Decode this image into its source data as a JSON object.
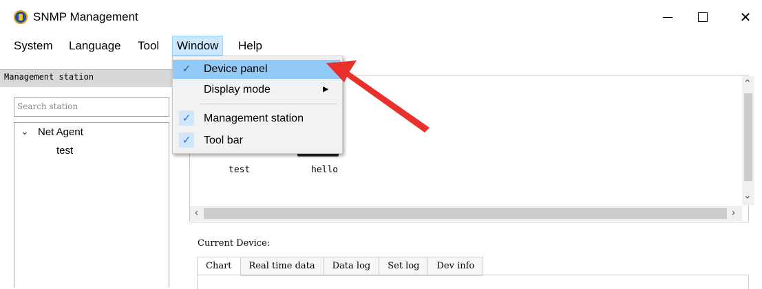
{
  "window": {
    "title": "SNMP Management"
  },
  "menubar": {
    "items": [
      {
        "label": "System"
      },
      {
        "label": "Language"
      },
      {
        "label": "Tool"
      },
      {
        "label": "Window"
      },
      {
        "label": "Help"
      }
    ]
  },
  "window_menu": {
    "items": [
      {
        "label": "Device panel",
        "checked": true,
        "highlighted": true
      },
      {
        "label": "Display mode",
        "checked": false,
        "has_submenu": true
      },
      {
        "label": "Management station",
        "checked": true
      },
      {
        "label": "Tool bar",
        "checked": true
      }
    ]
  },
  "left_panel": {
    "header": "Management station",
    "search_placeholder": "Search station",
    "tree": {
      "root": "Net Agent",
      "children": [
        "test"
      ]
    }
  },
  "device_panel": {
    "devices": [
      {
        "label": "test"
      },
      {
        "label": "hello"
      }
    ]
  },
  "current_device": {
    "label": "Current Device:",
    "tabs": [
      "Chart",
      "Real time data",
      "Data log",
      "Set log",
      "Dev info"
    ],
    "active_tab": "Chart"
  },
  "colors": {
    "menu_highlight": "#91c9f7",
    "active_menubar": "#cce8ff",
    "annotation_arrow": "#e8312a"
  }
}
